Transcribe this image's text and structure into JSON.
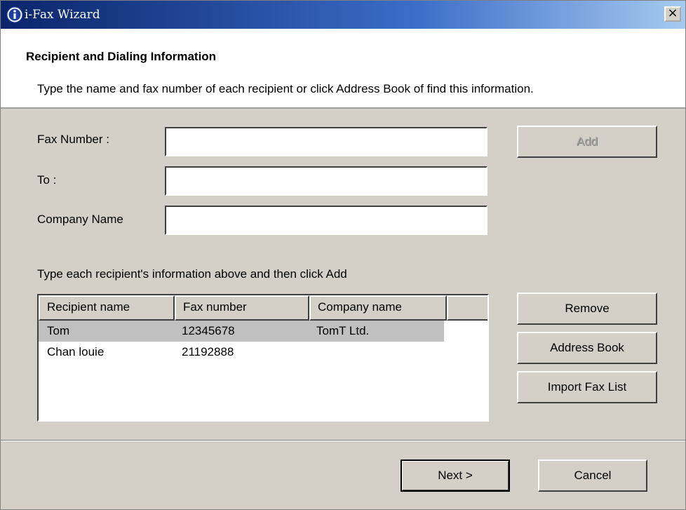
{
  "window": {
    "title": "i-Fax Wizard",
    "close_glyph": "×"
  },
  "header": {
    "title": "Recipient and Dialing Information",
    "subtitle": "Type the name and fax number of each recipient or click Address Book of find this information."
  },
  "form": {
    "fax_number_label": "Fax Number :",
    "fax_number_value": "",
    "to_label": "To :",
    "to_value": "",
    "company_label": "Company Name",
    "company_value": "",
    "add_label": "Add"
  },
  "list": {
    "hint": "Type each recipient's information above and then click Add",
    "columns": [
      "Recipient name",
      "Fax number",
      "Company name",
      ""
    ],
    "rows": [
      {
        "name": "Tom",
        "fax": "12345678",
        "company": "TomT Ltd."
      },
      {
        "name": "Chan louie",
        "fax": "21192888",
        "company": ""
      }
    ]
  },
  "side_buttons": {
    "remove": "Remove",
    "address_book": "Address Book",
    "import_fax_list": "Import Fax List"
  },
  "footer": {
    "next": "Next >",
    "cancel": "Cancel"
  },
  "colors": {
    "title_start": "#0a246a",
    "title_end": "#a6caf0",
    "face": "#d4d0c8",
    "selection": "#c0c0c0"
  },
  "icons": {
    "app": "info-icon",
    "close": "close-icon"
  }
}
